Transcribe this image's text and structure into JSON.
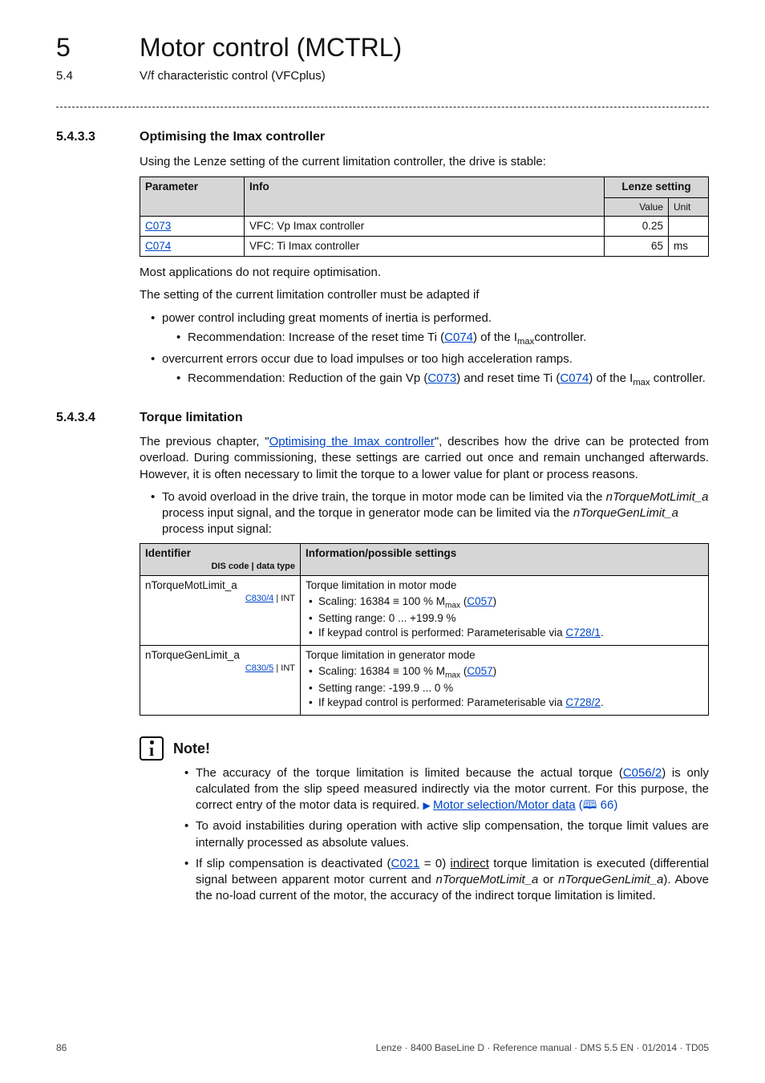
{
  "header": {
    "chapterNumber": "5",
    "chapterTitle": "Motor control (MCTRL)",
    "sectionNumber": "5.4",
    "sectionTitle": "V/f characteristic control (VFCplus)"
  },
  "sec1": {
    "num": "5.4.3.3",
    "title": "Optimising the Imax controller",
    "intro": "Using the Lenze setting of the current limitation controller, the drive is stable:",
    "tableHeaders": {
      "param": "Parameter",
      "info": "Info",
      "lenze": "Lenze setting",
      "value": "Value",
      "unit": "Unit"
    },
    "rows": [
      {
        "param": "C073",
        "paramIsLink": true,
        "info": "VFC: Vp Imax controller",
        "value": "0.25",
        "unit": ""
      },
      {
        "param": "C074",
        "paramIsLink": true,
        "info": "VFC: Ti Imax controller",
        "value": "65",
        "unit": "ms"
      }
    ],
    "p1": "Most applications do not require optimisation.",
    "p2": "The setting of the current limitation controller must be adapted if",
    "b1a": "power control including great moments of inertia is performed.",
    "b1a_rec_pre": "Recommendation: Increase of the reset time Ti (",
    "b1a_rec_link": "C074",
    "b1a_rec_post": ") of the I",
    "b1a_rec_sub": "max",
    "b1a_rec_tail": "controller.",
    "b1b": "overcurrent errors occur due to load impulses or too high acceleration ramps.",
    "b1b_rec_pre": "Recommendation: Reduction of the gain Vp (",
    "b1b_rec_link1": "C073",
    "b1b_rec_mid": ") and reset time Ti (",
    "b1b_rec_link2": "C074",
    "b1b_rec_post": ") of the I",
    "b1b_rec_sub": "max",
    "b1b_rec_tail": " controller."
  },
  "sec2": {
    "num": "5.4.3.4",
    "title": "Torque limitation",
    "p1_pre": "The previous chapter, \"",
    "p1_link": "Optimising the Imax controller",
    "p1_post": "\", describes how the drive can be protected from overload. During commissioning, these settings are carried out once and remain unchanged afterwards. However, it is often necessary to limit the torque to a lower value for plant or process reasons.",
    "b_pre": "To avoid overload in the drive train, the torque in motor mode can be limited via the ",
    "b_i1": "nTorqueMotLimit_a",
    "b_mid": " process input signal, and the torque in generator mode can be limited via the ",
    "b_i2": "nTorqueGenLimit_a",
    "b_tail": " process input signal:",
    "tbl": {
      "h1": "Identifier",
      "h1sub": "DIS code | data type",
      "h2": "Information/possible settings",
      "r1": {
        "id": "nTorqueMotLimit_a",
        "code": "C830/4",
        "type": " | INT",
        "l1": "Torque limitation in motor mode",
        "l2_pre": "Scaling: 16384 ≡ 100 % M",
        "l2_sub": "max",
        "l2_mid": " (",
        "l2_link": "C057",
        "l2_post": ")",
        "l3": "Setting range: 0 ... +199.9 %",
        "l4_pre": "If keypad control is performed: Parameterisable via ",
        "l4_link": "C728/1",
        "l4_post": "."
      },
      "r2": {
        "id": "nTorqueGenLimit_a",
        "code": "C830/5",
        "type": " | INT",
        "l1": "Torque limitation in generator mode",
        "l2_pre": "Scaling: 16384 ≡ 100 % M",
        "l2_sub": "max",
        "l2_mid": " (",
        "l2_link": "C057",
        "l2_post": ")",
        "l3": "Setting range: -199.9 ... 0 %",
        "l4_pre": "If keypad control is performed: Parameterisable via ",
        "l4_link": "C728/2",
        "l4_post": "."
      }
    }
  },
  "note": {
    "title": "Note!",
    "n1_pre": "The accuracy of the torque limitation is limited because the actual torque (",
    "n1_link": "C056/2",
    "n1_mid": ") is only calculated from the slip speed measured indirectly via the motor current. For this purpose, the correct entry of the motor data is required.  ",
    "n1_link2": "Motor selection/Motor data",
    "n1_book": " (🕮 66)",
    "n2": "To avoid instabilities during operation with active slip compensation, the torque limit values are internally processed as absolute values.",
    "n3_pre": "If slip compensation is deactivated (",
    "n3_link": "C021",
    "n3_mid": " = 0) ",
    "n3_u": "indirect",
    "n3_mid2": " torque limitation is executed (differential signal between apparent motor current and ",
    "n3_i1": "nTorqueMotLimit_a",
    "n3_or": " or ",
    "n3_i2": "nTorqueGenLimit_a",
    "n3_tail": "). Above the no-load current of the motor, the accuracy of the indirect torque limitation is limited."
  },
  "footer": {
    "page": "86",
    "right": "Lenze · 8400 BaseLine D · Reference manual · DMS 5.5 EN · 01/2014 · TD05"
  }
}
